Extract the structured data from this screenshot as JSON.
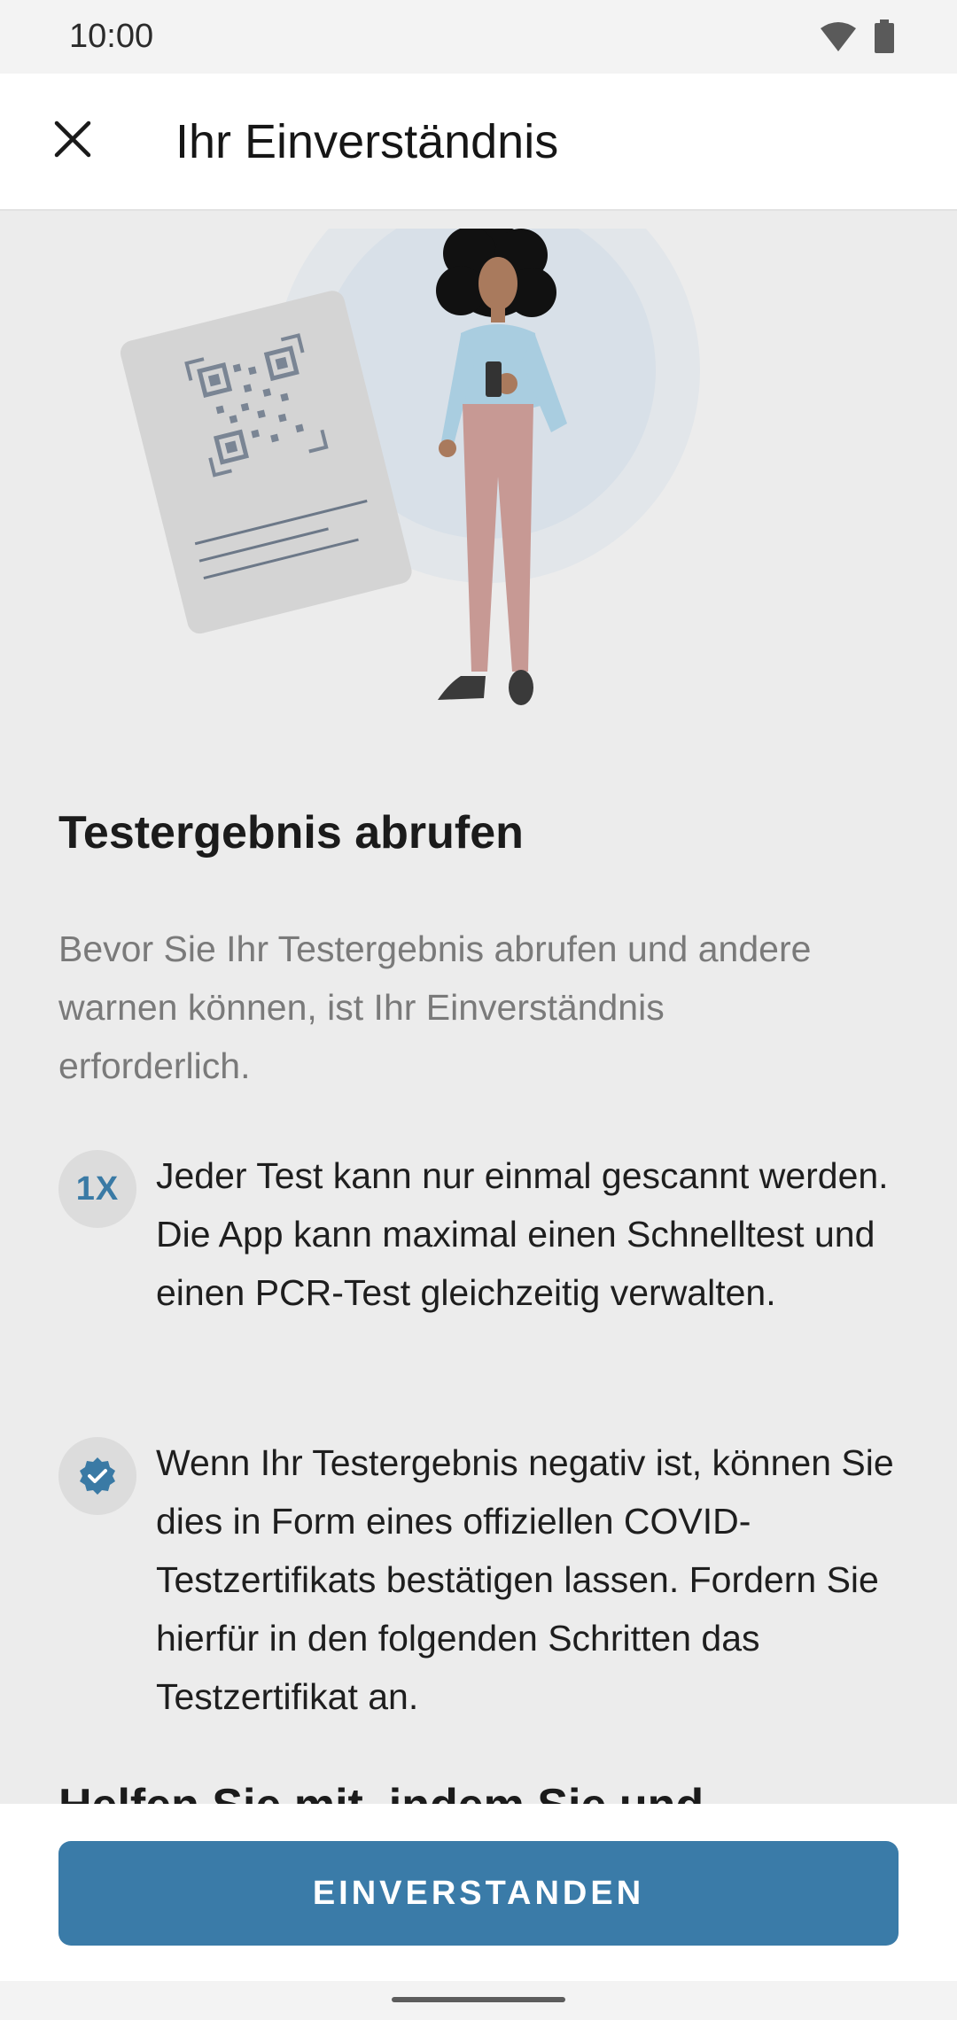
{
  "status_bar": {
    "time": "10:00",
    "icons": [
      "wifi-icon",
      "battery-icon"
    ]
  },
  "app_bar": {
    "close_icon": "close-icon",
    "title": "Ihr Einverständnis"
  },
  "content": {
    "illustration": "person-with-qr-code-test-card",
    "section_title": "Testergebnis abrufen",
    "intro": "Bevor Sie Ihr Testergebnis abrufen und andere warnen können, ist Ihr Einverständnis erforderlich.",
    "bullets": [
      {
        "icon": "once-icon",
        "icon_label": "1X",
        "text": "Jeder Test kann nur einmal gescannt werden. Die App kann maximal einen Schnelltest und einen PCR-Test gleichzeitig verwalten."
      },
      {
        "icon": "verified-badge-icon",
        "text": "Wenn Ihr Testergebnis negativ ist, können Sie dies in Form eines offiziellen COVID-Testzertifikats bestätigen lassen. Fordern Sie hierfür in den folgenden Schritten das Testzertifikat an."
      }
    ],
    "next_heading_partial": "Helfen Sie mit, indem Sie und"
  },
  "actions": {
    "agree_label": "EINVERSTANDEN"
  },
  "colors": {
    "accent": "#3a7ba8",
    "background": "#ececec",
    "secondary_text": "#7a7a7a"
  }
}
